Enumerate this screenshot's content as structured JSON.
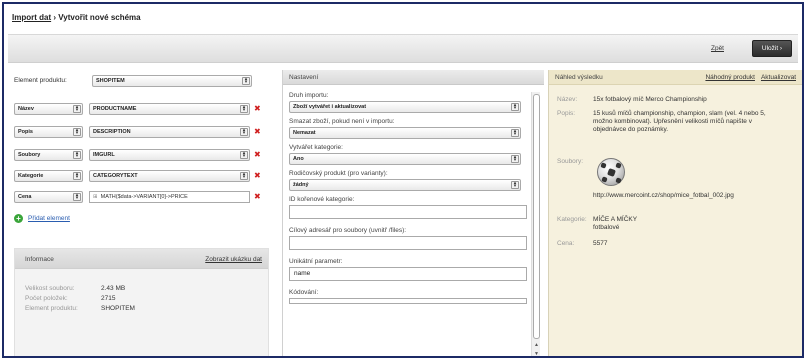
{
  "breadcrumb": {
    "parent": "Import dat",
    "separator": " › ",
    "current": "Vytvořit nové schéma"
  },
  "toolbar": {
    "cancel": "Zpět",
    "save": "Uložit ›"
  },
  "product_element": {
    "label": "Element produktu:",
    "value": "SHOPITEM"
  },
  "mappings": [
    {
      "field": "Název",
      "source": "PRODUCTNAME"
    },
    {
      "field": "Popis",
      "source": "DESCRIPTION"
    },
    {
      "field": "Soubory",
      "source": "IMGURL"
    },
    {
      "field": "Kategorie",
      "source": "CATEGORYTEXT"
    },
    {
      "field": "Cena",
      "source": "MATH($data->VARIANT[0]->PRICE"
    }
  ],
  "add_element": "Přidat element",
  "info": {
    "title": "Informace",
    "sample_link": "Zobrazit ukázku dat",
    "rows": [
      {
        "key": "Velikost souboru:",
        "value": "2.43 MB"
      },
      {
        "key": "Počet položek:",
        "value": "2715"
      },
      {
        "key": "Element produktu:",
        "value": "SHOPITEM"
      }
    ]
  },
  "settings": {
    "title": "Nastavení",
    "import_type_label": "Druh importu:",
    "import_type_value": "Zboží vytvářet i aktualizovat",
    "delete_label": "Smazat zboží, pokud není v importu:",
    "delete_value": "Nemazat",
    "create_category_label": "Vytvářet kategorie:",
    "create_category_value": "Ano",
    "parent_product_label": "Rodičovský produkt (pro varianty):",
    "parent_product_value": "žádný",
    "root_category_label": "ID kořenové kategorie:",
    "root_category_value": "",
    "target_dir_label": "Cílový adresář pro soubory (uvnitř /files):",
    "target_dir_value": "",
    "unique_param_label": "Unikátní parametr:",
    "unique_param_value": "name",
    "encoding_label": "Kódování:"
  },
  "preview": {
    "title": "Náhled výsledku",
    "random_link": "Náhodný produkt",
    "refresh_link": "Aktualizovat",
    "name_key": "Název:",
    "name_value": "15x fotbalový míč Merco Championship",
    "desc_key": "Popis:",
    "desc_value": "15 kusů míčů championship, champion, slam (vel. 4 nebo 5, možno kombinovat). Upřesnění velikosti míčů napište v objednávce do poznámky.",
    "files_key": "Soubory:",
    "file_url": "http://www.mercoint.cz/shop/mice_fotbal_002.jpg",
    "category_key": "Kategorie:",
    "category_value": "MÍČE A MÍČKY",
    "category_sub": "fotbalové",
    "price_key": "Cena:",
    "price_value": "5577"
  }
}
